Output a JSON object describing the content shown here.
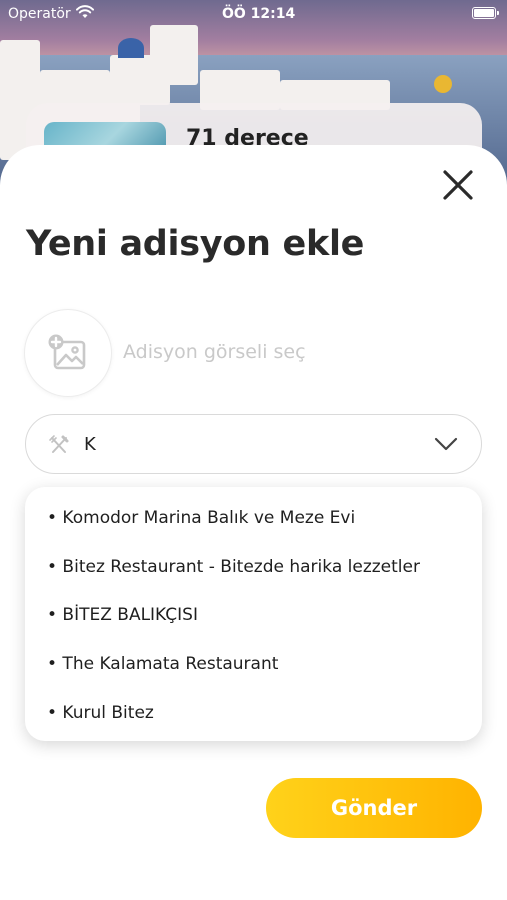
{
  "status_bar": {
    "carrier": "Operatör",
    "time": "ÖÖ 12:14"
  },
  "background_card": {
    "title": "71 derece"
  },
  "sheet": {
    "title": "Yeni adisyon ekle",
    "image_picker_label": "Adisyon görseli seç",
    "restaurant_select": {
      "value": "K",
      "icon": "fork-knife-icon"
    },
    "dropdown_options": [
      "• Komodor Marina Balık ve Meze Evi",
      "• Bitez Restaurant - Bitezde harika lezzetler",
      "• BİTEZ BALIKÇISI",
      "• The Kalamata Restaurant",
      "• Kurul Bitez"
    ],
    "submit_label": "Gönder"
  },
  "colors": {
    "accent_start": "#ffd21a",
    "accent_end": "#ffb300",
    "title": "#2a2a2a",
    "placeholder": "#c9c9c9"
  }
}
